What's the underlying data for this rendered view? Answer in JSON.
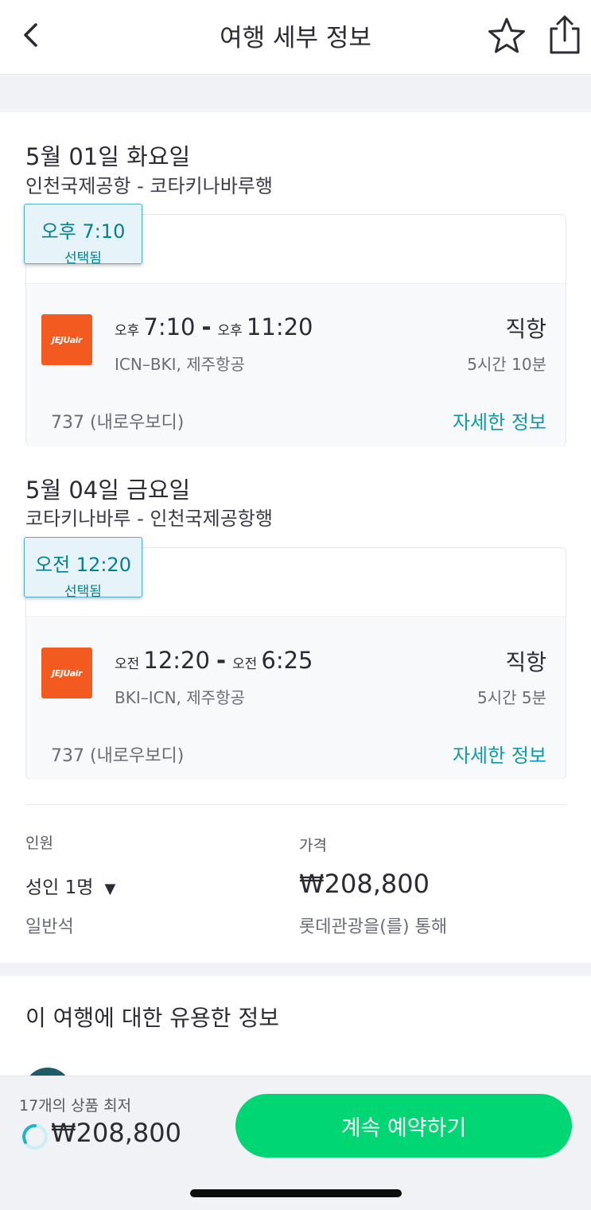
{
  "header": {
    "title": "여행 세부 정보"
  },
  "legs": [
    {
      "date": "5월 01일 화요일",
      "route": "인천국제공항 - 코타키나바루행",
      "tab_time": "오후 7:10",
      "tab_status": "선택됨",
      "airline_logo_text": "JEJUair",
      "dep_ampm": "오후",
      "dep_time": "7:10",
      "arr_ampm": "오후",
      "arr_time": "11:20",
      "route_code": "ICN–BKI, 제주항공",
      "stops": "직항",
      "duration": "5시간 10분",
      "aircraft": "737 (내로우보디)",
      "details_label": "자세한 정보"
    },
    {
      "date": "5월 04일 금요일",
      "route": "코타키나바루 - 인천국제공항행",
      "tab_time": "오전 12:20",
      "tab_status": "선택됨",
      "airline_logo_text": "JEJUair",
      "dep_ampm": "오전",
      "dep_time": "12:20",
      "arr_ampm": "오전",
      "arr_time": "6:25",
      "route_code": "BKI–ICN, 제주항공",
      "stops": "직항",
      "duration": "5시간 5분",
      "aircraft": "737 (내로우보디)",
      "details_label": "자세한 정보"
    }
  ],
  "summary": {
    "passengers_label": "인원",
    "passengers_value": "성인 1명",
    "passengers_caret": "▼",
    "cabin": "일반석",
    "price_label": "가격",
    "price": "₩208,800",
    "via": "롯데관광을(를) 통해"
  },
  "info_section": {
    "title": "이 여행에 대한 유용한 정보"
  },
  "bottom_bar": {
    "deals_label": "17개의 상품 최저",
    "price": "₩208,800",
    "cta_label": "계속 예약하기"
  },
  "colors": {
    "accent_teal": "#0c9aa8",
    "cta_green": "#00d774",
    "airline_orange": "#f25a1f",
    "tab_bg": "#e6f4fa"
  },
  "icons": {
    "back": "chevron-left-icon",
    "favorite": "star-outline-icon",
    "share": "share-icon",
    "loading": "spinner-icon"
  }
}
